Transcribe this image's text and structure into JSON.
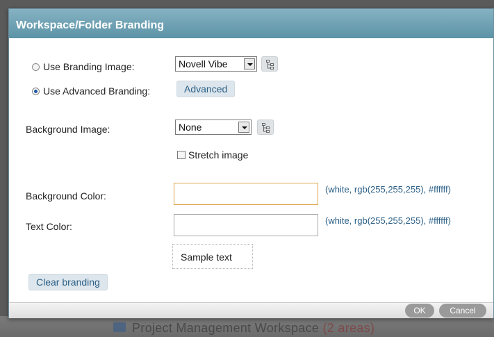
{
  "background_app": {
    "text": "Project Management Workspace",
    "badge": "(2 areas)"
  },
  "dialog": {
    "title": "Workspace/Folder Branding",
    "branding_image": {
      "label": "Use Branding Image:",
      "selected_value": "Novell Vibe",
      "checked": false
    },
    "advanced_branding": {
      "label": "Use Advanced Branding:",
      "checked": true,
      "button_label": "Advanced"
    },
    "background_image": {
      "label": "Background Image:",
      "selected_value": "None",
      "stretch_label": "Stretch image",
      "stretch_checked": false
    },
    "background_color": {
      "label": "Background Color:",
      "value": "",
      "hint": "(white, rgb(255,255,255), #ffffff)"
    },
    "text_color": {
      "label": "Text Color:",
      "value": "",
      "hint": "(white, rgb(255,255,255), #ffffff)"
    },
    "sample_text": "Sample text",
    "clear_button": "Clear branding",
    "ok_button": "OK",
    "cancel_button": "Cancel"
  },
  "colors": {
    "title_bar": "#5c93a6",
    "link": "#2b5f86",
    "focus_border": "#e0a54a"
  }
}
